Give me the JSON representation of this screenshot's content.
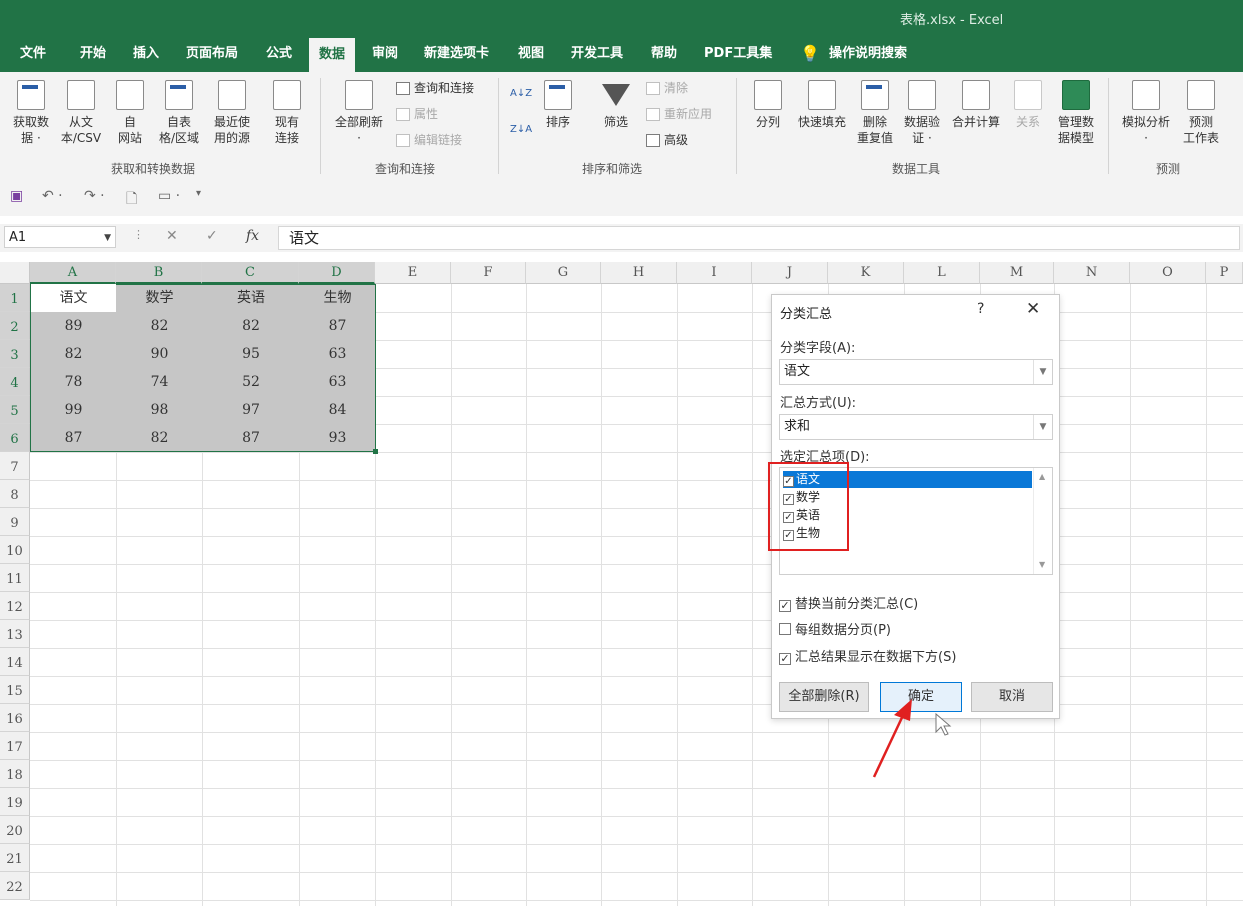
{
  "window": {
    "title": "表格.xlsx  -  Excel"
  },
  "menu": [
    "文件",
    "开始",
    "插入",
    "页面布局",
    "公式",
    "数据",
    "审阅",
    "新建选项卡",
    "视图",
    "开发工具",
    "帮助",
    "PDF工具集",
    "操作说明搜索"
  ],
  "ribbon": {
    "get_data": "获取数\n据 ·",
    "from_csv": "从文\n本/CSV",
    "from_web": "自\n网站",
    "from_table": "自表\n格/区域",
    "recent_sources": "最近使\n用的源",
    "existing_conn": "现有\n连接",
    "group_get_transform": "获取和转换数据",
    "refresh_all": "全部刷新\n·",
    "queries_conn": "查询和连接",
    "properties": "属性",
    "edit_links": "编辑链接",
    "group_queries": "查询和连接",
    "sort": "排序",
    "filter": "筛选",
    "clear": "清除",
    "reapply": "重新应用",
    "advanced": "高级",
    "group_sort_filter": "排序和筛选",
    "text_to_columns": "分列",
    "flash_fill": "快速填充",
    "remove_dup": "删除\n重复值",
    "data_validation": "数据验\n证 ·",
    "consolidate": "合并计算",
    "relationships": "关系",
    "manage_model": "管理数\n据模型",
    "group_data_tools": "数据工具",
    "whatif": "模拟分析\n·",
    "forecast_sheet": "预测\n工作表",
    "group_forecast": "预测"
  },
  "formula_bar": {
    "name_box": "A1",
    "fx": "fx",
    "content": "语文"
  },
  "sheet": {
    "columns": [
      "A",
      "B",
      "C",
      "D",
      "E",
      "F",
      "G",
      "H",
      "I",
      "J",
      "K",
      "L",
      "M",
      "N",
      "O",
      "P"
    ],
    "rows": [
      "1",
      "2",
      "3",
      "4",
      "5",
      "6",
      "7",
      "8",
      "9",
      "10",
      "11",
      "12",
      "13",
      "14",
      "15",
      "16",
      "17",
      "18",
      "19",
      "20",
      "21",
      "22"
    ],
    "header": [
      "语文",
      "数学",
      "英语",
      "生物"
    ],
    "data": [
      [
        "89",
        "82",
        "82",
        "87"
      ],
      [
        "82",
        "90",
        "95",
        "63"
      ],
      [
        "78",
        "74",
        "52",
        "63"
      ],
      [
        "99",
        "98",
        "97",
        "84"
      ],
      [
        "87",
        "82",
        "87",
        "93"
      ]
    ]
  },
  "dialog": {
    "title": "分类汇总",
    "help": "?",
    "close": "✕",
    "group_by_label": "分类字段(A):",
    "group_by_value": "语文",
    "function_label": "汇总方式(U):",
    "function_value": "求和",
    "subtotal_items_label": "选定汇总项(D):",
    "items": [
      {
        "label": "语文",
        "checked": true,
        "selected": true
      },
      {
        "label": "数学",
        "checked": true
      },
      {
        "label": "英语",
        "checked": true
      },
      {
        "label": "生物",
        "checked": true
      }
    ],
    "replace_current": "替换当前分类汇总(C)",
    "page_break": "每组数据分页(P)",
    "summary_below": "汇总结果显示在数据下方(S)",
    "remove_all": "全部删除(R)",
    "ok": "确定",
    "cancel": "取消"
  },
  "colors": {
    "excel_green": "#217346",
    "selection_blue": "#0a78d7",
    "annotation_red": "#e02020"
  }
}
